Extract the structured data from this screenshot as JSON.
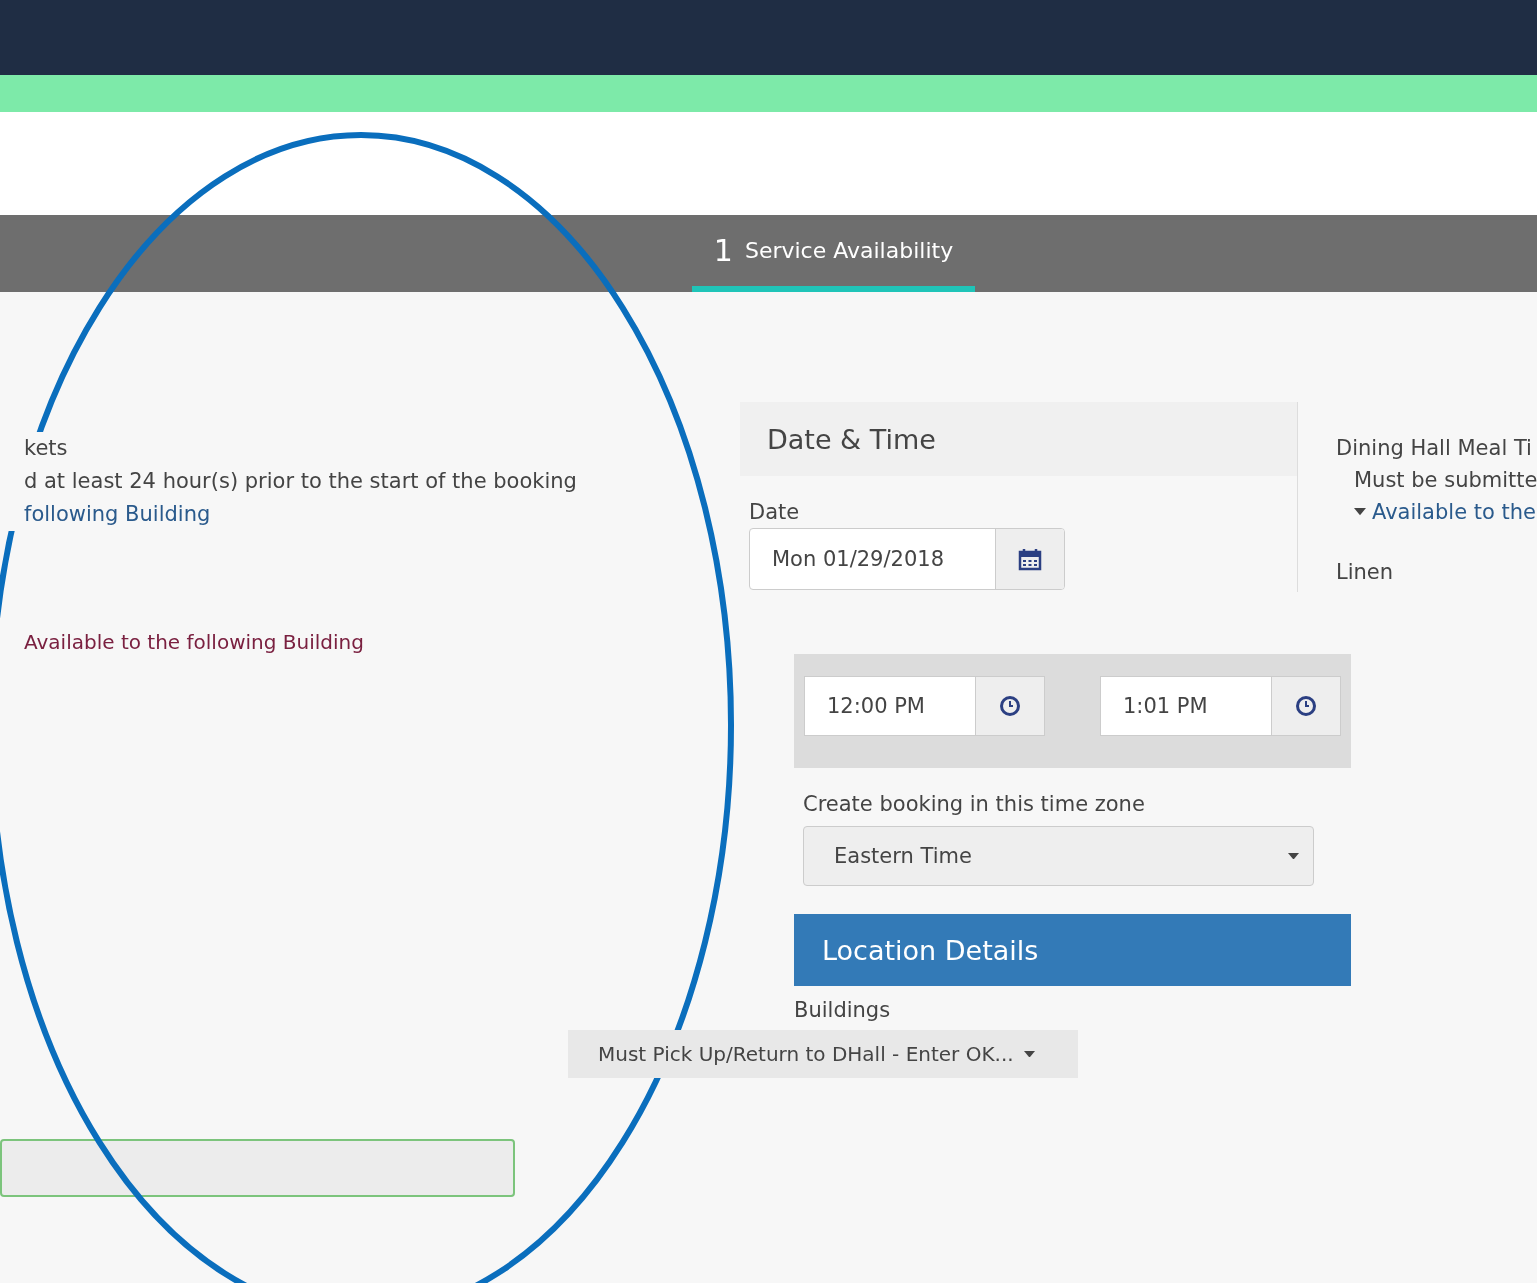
{
  "step": {
    "number": "1",
    "label": "Service Availability",
    "selected": true
  },
  "left_panel": {
    "lines": [
      "kets",
      "d at least 24 hour(s) prior to the start of the booking"
    ],
    "link": "following Building",
    "note": "Available to the following Building"
  },
  "booking": {
    "section_title": "Date & Time",
    "date": {
      "label": "Date",
      "value": "Mon 01/29/2018"
    },
    "times": [
      {
        "value": "12:00 PM"
      },
      {
        "value": "1:01 PM"
      }
    ],
    "timezone": {
      "label": "Create booking in this time zone",
      "value": "Eastern Time"
    },
    "location": {
      "title": "Location Details",
      "buildings_label": "Buildings",
      "buildings_value": "Must Pick Up/Return to DHall - Enter OK..."
    }
  },
  "right_panel": {
    "title": "Dining Hall Meal Ti",
    "line": "Must be submitte",
    "link": "Available to the",
    "linen": "Linen"
  }
}
